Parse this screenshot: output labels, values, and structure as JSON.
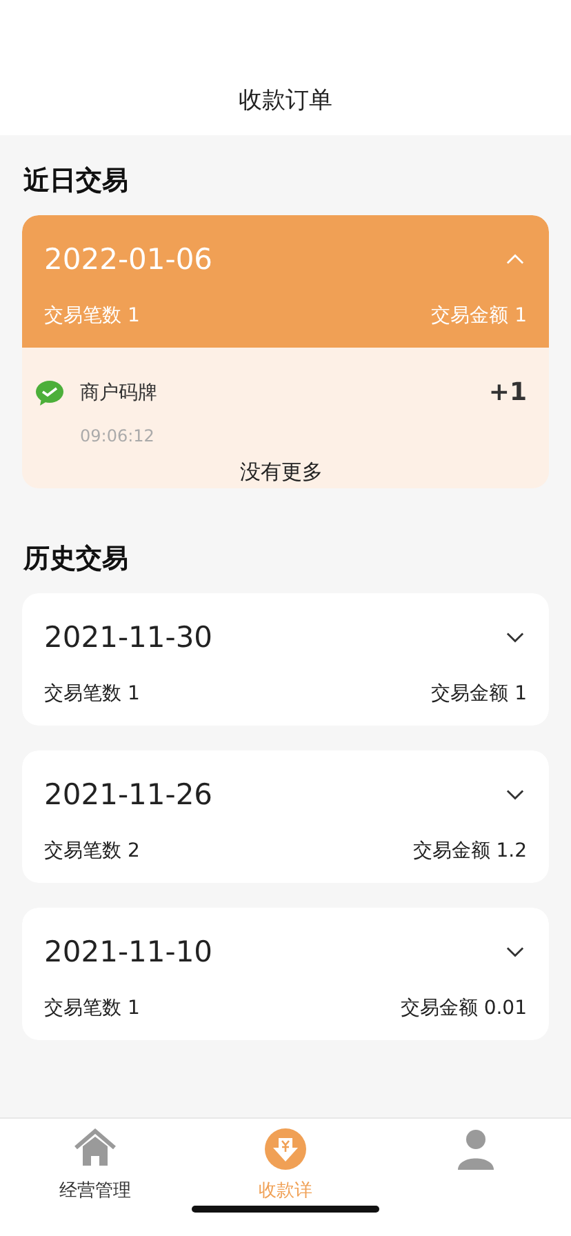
{
  "header": {
    "title": "收款订单"
  },
  "recent": {
    "title": "近日交易",
    "days": [
      {
        "date": "2022-01-06",
        "count": "交易笔数 1",
        "amount": "交易金额 1",
        "expanded": true,
        "transactions": [
          {
            "name": "商户码牌",
            "value": "+1",
            "time": "09:06:12"
          }
        ],
        "end_note": "没有更多"
      }
    ]
  },
  "history": {
    "title": "历史交易",
    "days": [
      {
        "date": "2021-11-30",
        "count": "交易笔数 1",
        "amount": "交易金额 1",
        "expanded": false
      },
      {
        "date": "2021-11-26",
        "count": "交易笔数 2",
        "amount": "交易金额 1.2",
        "expanded": false
      },
      {
        "date": "2021-11-10",
        "count": "交易笔数 1",
        "amount": "交易金额 0.01",
        "expanded": false
      }
    ]
  },
  "tab_bar": {
    "tabs": [
      {
        "kind": "home",
        "label": "经营管理",
        "selected": false
      },
      {
        "kind": "money",
        "label": "收款详",
        "selected": true
      },
      {
        "kind": "person",
        "selected": false
      }
    ]
  }
}
